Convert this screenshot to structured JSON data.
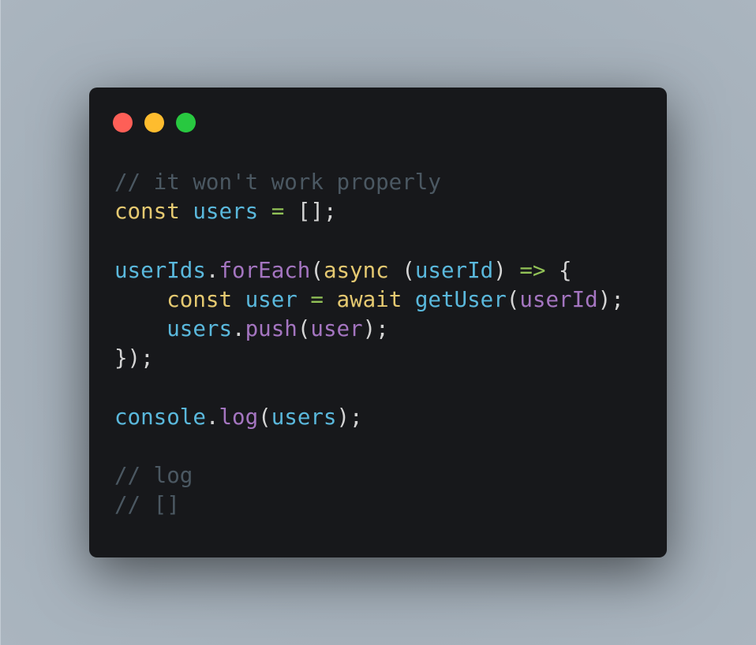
{
  "window": {
    "controls": [
      {
        "name": "close",
        "color": "#fe5f57"
      },
      {
        "name": "minimize",
        "color": "#febc2e"
      },
      {
        "name": "maximize",
        "color": "#28c840"
      }
    ]
  },
  "code": {
    "language": "javascript",
    "lines": [
      [
        {
          "t": "cm",
          "v": "// it won't work properly"
        }
      ],
      [
        {
          "t": "kw",
          "v": "const"
        },
        {
          "t": "pn",
          "v": " "
        },
        {
          "t": "var",
          "v": "users"
        },
        {
          "t": "pn",
          "v": " "
        },
        {
          "t": "op",
          "v": "="
        },
        {
          "t": "pn",
          "v": " [];"
        }
      ],
      [],
      [
        {
          "t": "var",
          "v": "userIds"
        },
        {
          "t": "pn",
          "v": "."
        },
        {
          "t": "fn",
          "v": "forEach"
        },
        {
          "t": "pn",
          "v": "("
        },
        {
          "t": "kw",
          "v": "async"
        },
        {
          "t": "pn",
          "v": " ("
        },
        {
          "t": "var",
          "v": "userId"
        },
        {
          "t": "pn",
          "v": ") "
        },
        {
          "t": "op",
          "v": "=>"
        },
        {
          "t": "pn",
          "v": " {"
        }
      ],
      [
        {
          "t": "pn",
          "v": "    "
        },
        {
          "t": "kw",
          "v": "const"
        },
        {
          "t": "pn",
          "v": " "
        },
        {
          "t": "var",
          "v": "user"
        },
        {
          "t": "pn",
          "v": " "
        },
        {
          "t": "op",
          "v": "="
        },
        {
          "t": "pn",
          "v": " "
        },
        {
          "t": "kw",
          "v": "await"
        },
        {
          "t": "pn",
          "v": " "
        },
        {
          "t": "var",
          "v": "getUser"
        },
        {
          "t": "pn",
          "v": "("
        },
        {
          "t": "fn",
          "v": "userId"
        },
        {
          "t": "pn",
          "v": ");"
        }
      ],
      [
        {
          "t": "pn",
          "v": "    "
        },
        {
          "t": "var",
          "v": "users"
        },
        {
          "t": "pn",
          "v": "."
        },
        {
          "t": "fn",
          "v": "push"
        },
        {
          "t": "pn",
          "v": "("
        },
        {
          "t": "fn",
          "v": "user"
        },
        {
          "t": "pn",
          "v": ");"
        }
      ],
      [
        {
          "t": "pn",
          "v": "});"
        }
      ],
      [],
      [
        {
          "t": "var",
          "v": "console"
        },
        {
          "t": "pn",
          "v": "."
        },
        {
          "t": "fn",
          "v": "log"
        },
        {
          "t": "pn",
          "v": "("
        },
        {
          "t": "var",
          "v": "users"
        },
        {
          "t": "pn",
          "v": ");"
        }
      ],
      [],
      [
        {
          "t": "cm",
          "v": "// log"
        }
      ],
      [
        {
          "t": "cm",
          "v": "// []"
        }
      ]
    ]
  }
}
